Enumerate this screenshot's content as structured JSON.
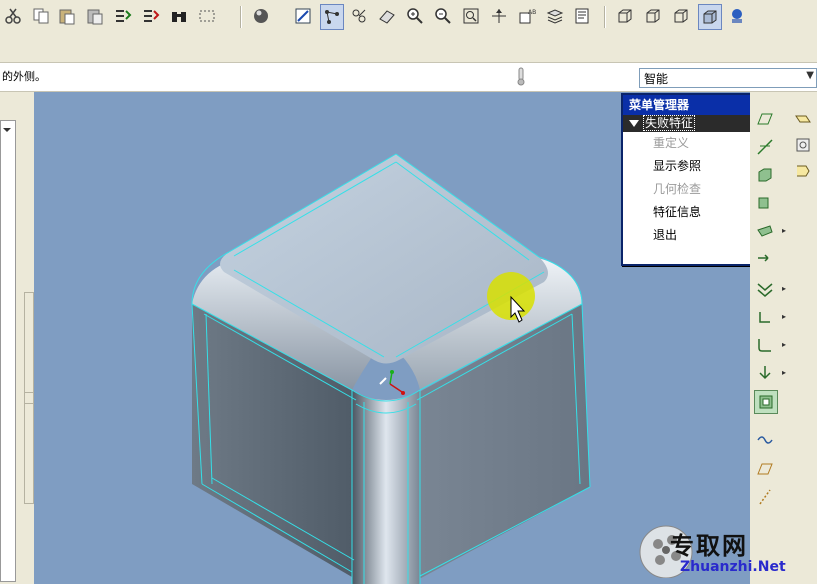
{
  "message": {
    "text": "的外侧。"
  },
  "filter": {
    "selected": "智能"
  },
  "menu_manager": {
    "title": "菜单管理器",
    "section": "失败特征",
    "items": [
      {
        "label": "重定义",
        "enabled": false
      },
      {
        "label": "显示参照",
        "enabled": true
      },
      {
        "label": "几何检查",
        "enabled": false
      },
      {
        "label": "特征信息",
        "enabled": true
      },
      {
        "label": "退出",
        "enabled": true
      }
    ]
  },
  "watermark": {
    "brand": "专取网",
    "url": "Zhuanzhi.Net"
  },
  "toolbar": {
    "icons": [
      "cut-icon",
      "copy-icon",
      "paste-icon",
      "paste-special-icon",
      "regenerate-icon",
      "regen-manager-icon",
      "find-icon",
      "select-box-icon",
      "shading-sphere-icon",
      "datum-display-icon",
      "spin-center-icon",
      "view-manager-icon",
      "orient-icon",
      "zoom-in-icon",
      "zoom-out-icon",
      "refit-icon",
      "reorient-icon",
      "saved-views-icon",
      "layers-icon",
      "model-tree-icon",
      "wireframe-icon",
      "hidden-line-icon",
      "no-hidden-icon",
      "shading-icon",
      "enhanced-realism-icon"
    ]
  },
  "colors": {
    "viewport_bg": "#7f9dc2",
    "menu_title_bg": "#0a2fa8",
    "edge_cyan": "#35e0e8",
    "highlight": "#d8e000"
  }
}
